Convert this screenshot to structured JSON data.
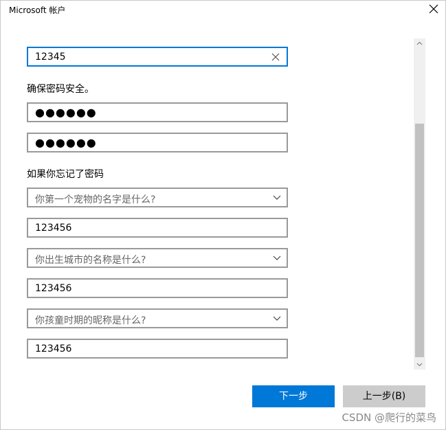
{
  "window": {
    "title": "Microsoft 帐户"
  },
  "form": {
    "username_value": "12345",
    "password_hint": "确保密码安全。",
    "password_value": "●●●●●●",
    "confirm_password_value": "●●●●●●",
    "security_heading": "如果你忘记了密码",
    "questions": [
      {
        "question": "你第一个宠物的名字是什么?",
        "answer": "123456"
      },
      {
        "question": "你出生城市的名称是什么?",
        "answer": "123456"
      },
      {
        "question": "你孩童时期的昵称是什么?",
        "answer": "123456"
      }
    ]
  },
  "buttons": {
    "next": "下一步",
    "back": "上一步(B)"
  },
  "watermark": "CSDN @爬行的菜鸟",
  "colors": {
    "accent": "#0078d7",
    "field_border": "#999999",
    "secondary_button": "#cccccc"
  }
}
